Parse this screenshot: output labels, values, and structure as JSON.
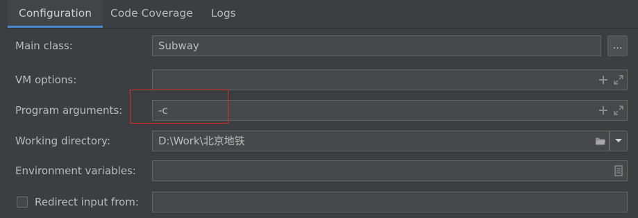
{
  "tabs": [
    {
      "label": "Configuration",
      "active": true
    },
    {
      "label": "Code Coverage",
      "active": false
    },
    {
      "label": "Logs",
      "active": false
    }
  ],
  "form": {
    "main_class": {
      "label": "Main class:",
      "value": "Subway",
      "browse_label": "..."
    },
    "vm_options": {
      "label": "VM options:",
      "value": ""
    },
    "program_arguments": {
      "label": "Program arguments:",
      "value": "-c"
    },
    "working_directory": {
      "label": "Working directory:",
      "value": "D:\\Work\\北京地铁"
    },
    "environment_variables": {
      "label": "Environment variables:",
      "value": ""
    },
    "redirect_input": {
      "label": "Redirect input from:",
      "checked": false,
      "value": ""
    }
  },
  "colors": {
    "accent": "#4a88c7",
    "highlight": "#e0292b",
    "background": "#3c3f41",
    "field": "#45494a"
  },
  "icons": {
    "expand": "expand-icon",
    "add": "plus-icon",
    "folder": "folder-icon",
    "dropdown": "chevron-down-icon",
    "document": "document-icon"
  }
}
